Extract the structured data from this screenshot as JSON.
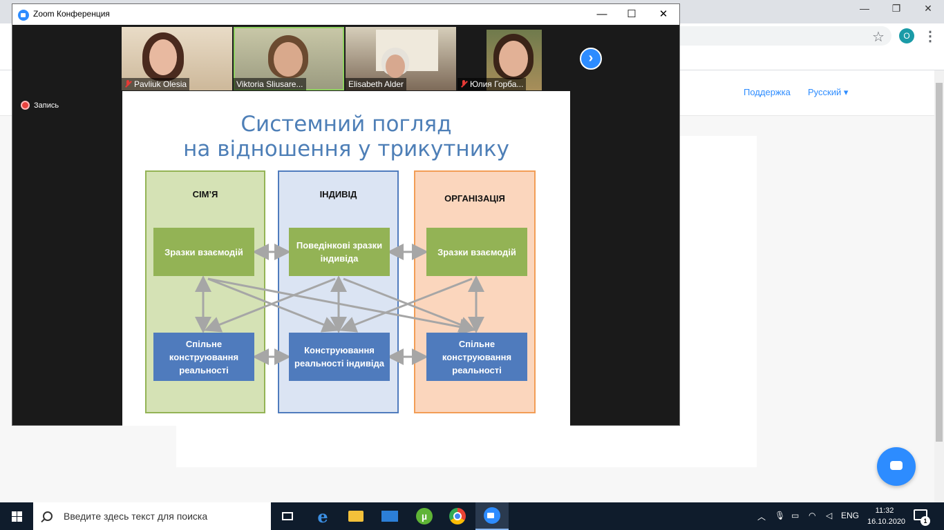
{
  "zoom": {
    "window_title": "Zoom Конференция",
    "minimize": "—",
    "maximize": "☐",
    "close": "✕",
    "recording_label": "Запись",
    "participants": [
      {
        "name": "Pavliuk Olesia",
        "muted": true
      },
      {
        "name": "Viktoria Sliusare...",
        "muted": false,
        "active_speaker": true
      },
      {
        "name": "Elisabeth Alder",
        "muted": false
      },
      {
        "name": "Юлия Горба...",
        "muted": true
      }
    ],
    "next_page": "›"
  },
  "slide": {
    "title_line1": "Системний погляд",
    "title_line2": "на відношення у трикутнику",
    "columns": [
      {
        "title": "СІМ’Я",
        "top_box": "Зразки взаємодій",
        "bottom_box": "Спільне конструювання реальності"
      },
      {
        "title": "ІНДИВІД",
        "top_box": "Поведінкові зразки індивіда",
        "bottom_box": "Конструювання реальності індивіда"
      },
      {
        "title": "ОРГАНІЗАЦІЯ",
        "top_box": "Зразки взаємодій",
        "bottom_box": "Спільне конструювання реальності"
      }
    ],
    "colors": {
      "col1_bg": "#d5e2b5",
      "col1_border": "#93b355",
      "col2_bg": "#dbe4f3",
      "col2_border": "#4f7bbd",
      "col3_bg": "#fbd6bd",
      "col3_border": "#f29d55",
      "green_box": "#93b355",
      "blue_box": "#4f7bbd",
      "arrow": "#a6a6a6"
    }
  },
  "browser": {
    "account_initial": "O",
    "links": [
      "Поддержка",
      "Русский"
    ],
    "language_caret": "▾"
  },
  "taskbar": {
    "search_placeholder": "Введите здесь текст для поиска",
    "apps": [
      "task-view",
      "edge",
      "file-explorer",
      "mail",
      "utorrent",
      "chrome",
      "zoom"
    ],
    "language": "ENG",
    "time": "11:32",
    "date": "16.10.2020",
    "notifications": "1"
  }
}
